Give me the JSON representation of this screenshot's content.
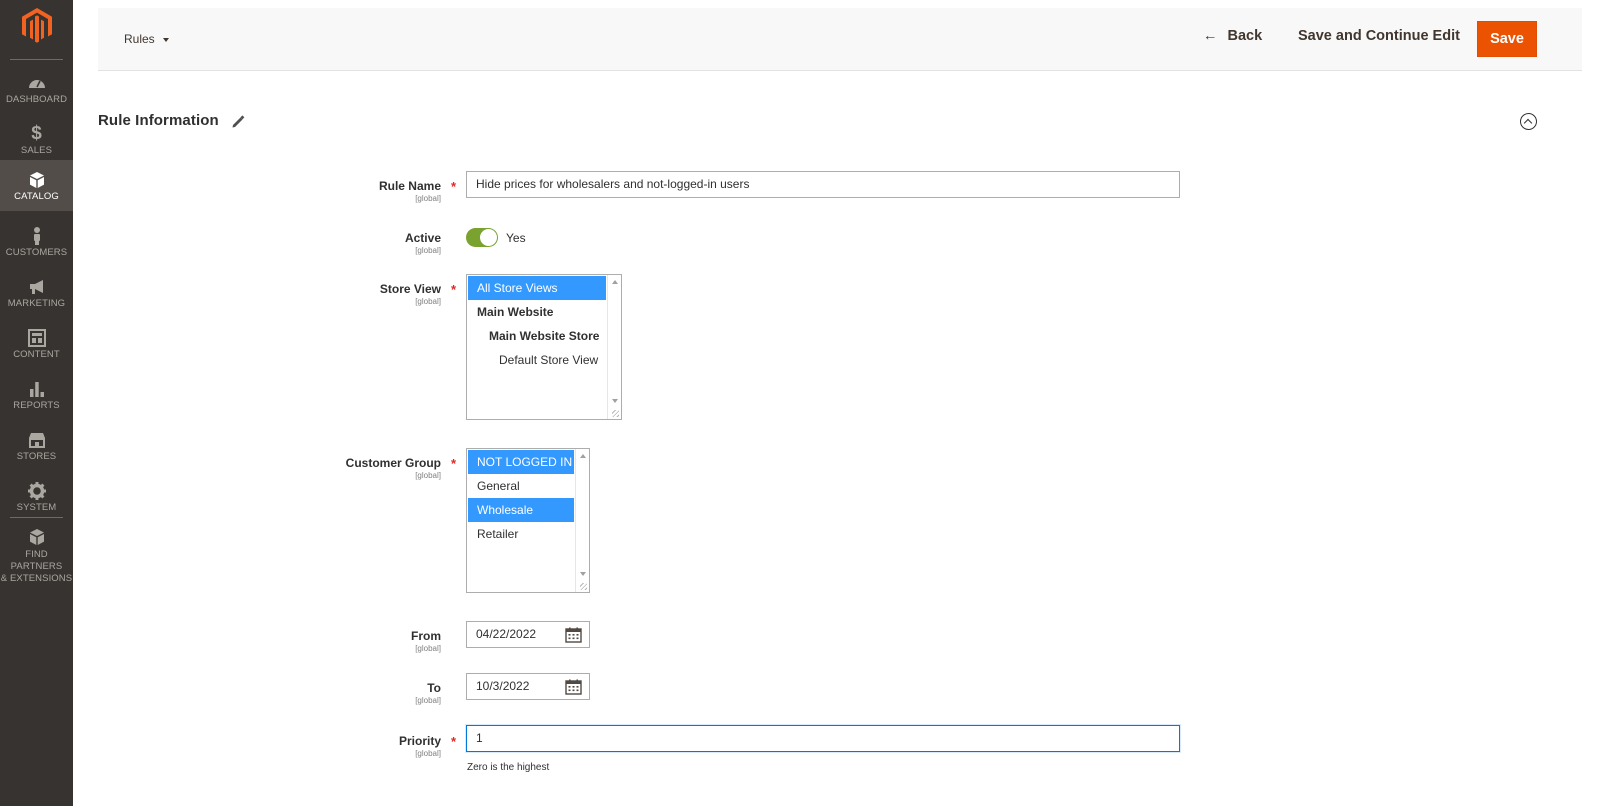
{
  "sidebar": {
    "items": [
      {
        "label": "Dashboard",
        "icon": "dashboard-icon"
      },
      {
        "label": "Sales",
        "icon": "dollar-icon"
      },
      {
        "label": "Catalog",
        "icon": "box-icon",
        "active": true
      },
      {
        "label": "Customers",
        "icon": "person-icon"
      },
      {
        "label": "Marketing",
        "icon": "megaphone-icon"
      },
      {
        "label": "Content",
        "icon": "layout-icon"
      },
      {
        "label": "Reports",
        "icon": "bar-chart-icon"
      },
      {
        "label": "Stores",
        "icon": "storefront-icon"
      },
      {
        "label": "System",
        "icon": "gear-icon"
      },
      {
        "label_line1": "Find Partners",
        "label_line2": "& Extensions",
        "icon": "cubes-icon"
      }
    ]
  },
  "toolbar": {
    "switcher_label": "Rules",
    "back_label": "Back",
    "continue_label": "Save and Continue Edit",
    "save_label": "Save"
  },
  "section": {
    "title": "Rule Information"
  },
  "form": {
    "scope": "[global]",
    "rule_name": {
      "label": "Rule Name",
      "value": "Hide prices for wholesalers and not-logged-in users"
    },
    "active": {
      "label": "Active",
      "value": "Yes"
    },
    "store_view": {
      "label": "Store View",
      "options": [
        "All Store Views",
        "Main Website",
        "Main Website Store",
        "Default Store View"
      ]
    },
    "customer_group": {
      "label": "Customer Group",
      "options": [
        "NOT LOGGED IN",
        "General",
        "Wholesale",
        "Retailer"
      ]
    },
    "from": {
      "label": "From",
      "value": "04/22/2022"
    },
    "to": {
      "label": "To",
      "value": "10/3/2022"
    },
    "priority": {
      "label": "Priority",
      "value": "1",
      "note": "Zero is the highest"
    }
  },
  "colors": {
    "sidebar_bg": "#373330",
    "accent": "#eb5202",
    "selection": "#3399ff",
    "toggle_on": "#79a22e"
  }
}
